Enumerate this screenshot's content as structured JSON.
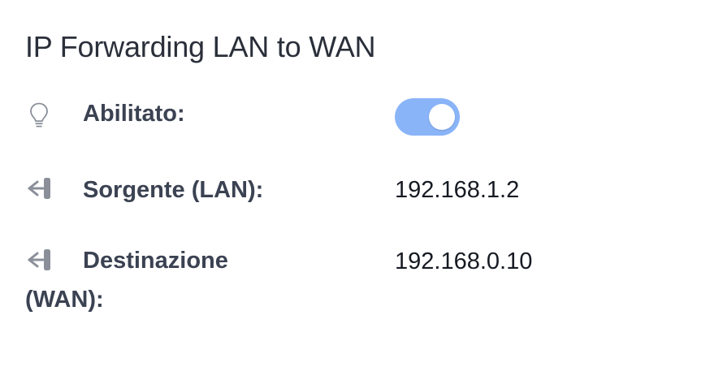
{
  "section": {
    "title": "IP Forwarding LAN to WAN"
  },
  "rows": {
    "enabled": {
      "icon": "lightbulb-icon",
      "label": "Abilitato:",
      "toggle_on": true,
      "toggle_color": "#8ab4f8"
    },
    "source": {
      "icon": "sign-in-icon",
      "label": "Sorgente (LAN):",
      "value": "192.168.1.2"
    },
    "destination": {
      "icon": "sign-in-icon",
      "label": "Destinazione (WAN):",
      "value": "192.168.0.10"
    }
  }
}
